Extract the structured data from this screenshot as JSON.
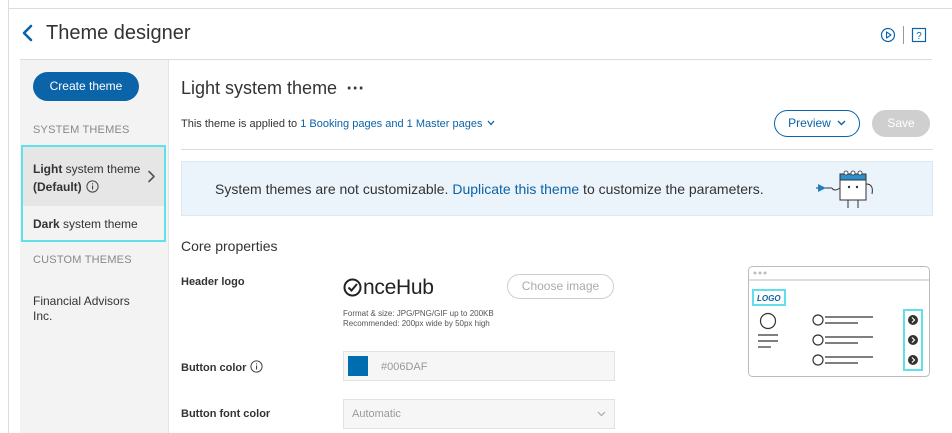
{
  "header": {
    "title": "Theme designer"
  },
  "sidebar": {
    "create_button": "Create theme",
    "system_section": "SYSTEM THEMES",
    "light_item": {
      "bold": "Light",
      "rest": " system theme",
      "default": "(Default)"
    },
    "dark_item": {
      "bold": "Dark",
      "rest": " system theme"
    },
    "custom_section": "CUSTOM THEMES",
    "custom_items": [
      "Financial Advisors Inc."
    ]
  },
  "main": {
    "theme_title": "Light system theme",
    "more_icon": "⋯",
    "applied_prefix": "This theme is applied to ",
    "applied_link": "1 Booking pages and 1 Master pages",
    "preview_button": "Preview",
    "save_button": "Save",
    "banner": {
      "text_before": "System themes are not customizable. ",
      "link": "Duplicate this theme",
      "text_after": " to customize the parameters."
    },
    "core_properties": {
      "title": "Core properties",
      "header_logo_label": "Header logo",
      "logo_text": "nceHub",
      "choose_image_button": "Choose image",
      "format_line1": "Format & size: JPG/PNG/GIF up to 200KB",
      "format_line2": "Recommended: 200px wide by 50px high",
      "button_color_label": "Button color",
      "button_color_value": "#006DAF",
      "button_font_color_label": "Button font color",
      "button_font_color_value": "Automatic"
    },
    "preview_diagram": {
      "logo_label": "LOGO"
    }
  },
  "colors": {
    "accent": "#0b63a8",
    "highlight": "#5fe0ea",
    "button_color": "#006DAF"
  },
  "icons": [
    "chevron-left-icon",
    "play-icon",
    "help-icon",
    "info-icon",
    "chevron-right-icon",
    "chevron-down-icon"
  ]
}
